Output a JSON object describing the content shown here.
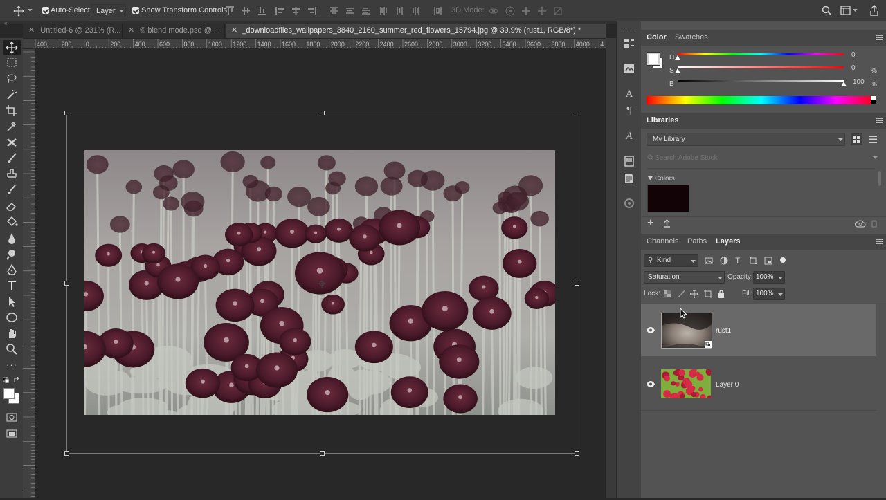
{
  "options_bar": {
    "auto_select_label": "Auto-Select:",
    "auto_select_value": "Layer",
    "transform_label": "Show Transform Controls",
    "mode_3d_label": "3D Mode:"
  },
  "tabs": [
    {
      "label": "Untitled-6 @ 231% (R..."
    },
    {
      "label": "© blend mode.psd @ ..."
    },
    {
      "label": "_downloadfiles_wallpapers_3840_2160_summer_red_flowers_15794.jpg @ 39.9% (rust1, RGB/8*) *"
    }
  ],
  "ruler": {
    "top_ticks": [
      "400",
      "200",
      "0",
      "200",
      "400",
      "600",
      "800",
      "1000",
      "1200",
      "1400",
      "1600",
      "1800",
      "2000",
      "2200",
      "2400",
      "2600",
      "2800",
      "3000",
      "3200",
      "3400",
      "3600",
      "3800",
      "4000",
      "4"
    ]
  },
  "color_panel": {
    "tab_color": "Color",
    "tab_swatches": "Swatches",
    "h_label": "H",
    "s_label": "S",
    "b_label": "B",
    "h_value": "0",
    "s_value": "0",
    "b_value": "100",
    "pct": "%",
    "h_level": 0,
    "s_level": 0,
    "b_level": 1.0
  },
  "libraries_panel": {
    "title": "Libraries",
    "library_select": "My Library",
    "search_placeholder": "Search Adobe Stock",
    "colors_group": "Colors",
    "swatch_color": "#120406"
  },
  "layers_panel": {
    "tab_channels": "Channels",
    "tab_paths": "Paths",
    "tab_layers": "Layers",
    "filter_kind": "Kind",
    "blend_mode": "Saturation",
    "opacity_label": "Opacity:",
    "opacity_value": "100%",
    "lock_label": "Lock:",
    "fill_label": "Fill:",
    "fill_value": "100%",
    "layers": [
      {
        "name": "rust1",
        "selected": true
      },
      {
        "name": "Layer 0",
        "selected": false
      }
    ]
  }
}
